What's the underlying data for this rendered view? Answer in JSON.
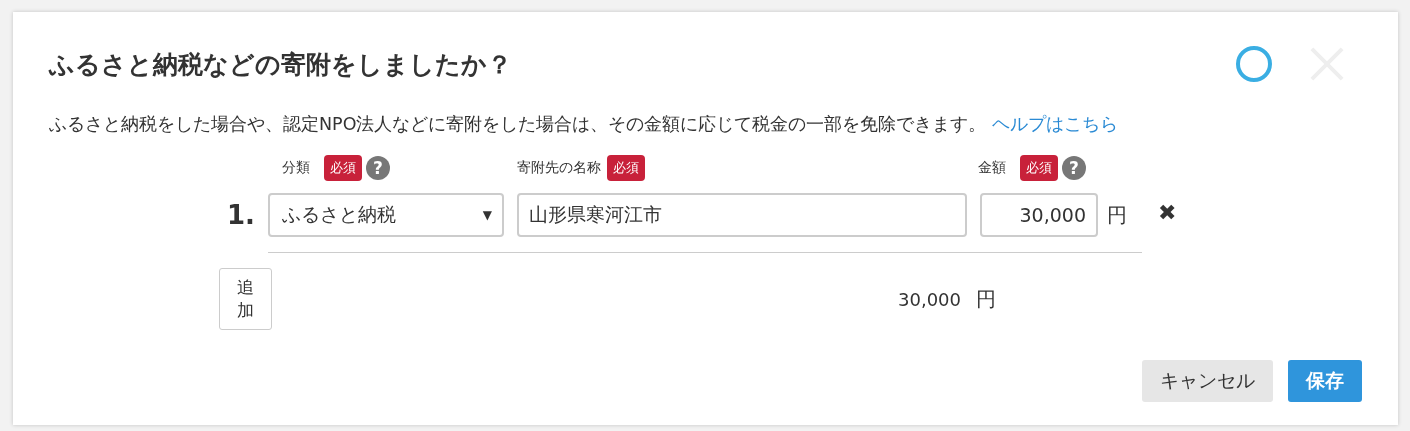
{
  "dialog": {
    "title": "ふるさと納税などの寄附をしましたか？",
    "description": "ふるさと納税をした場合や、認定NPO法人などに寄附をした場合は、その金額に応じて税金の一部を免除できます。",
    "help_link": "ヘルプはこちら"
  },
  "columns": [
    {
      "label": "分類",
      "required": "必須",
      "help": "?"
    },
    {
      "label": "寄附先の名称",
      "required": "必須"
    },
    {
      "label": "金額",
      "required": "必須",
      "help": "?"
    }
  ],
  "rows": [
    {
      "number": "1.",
      "category": "ふるさと納税",
      "category_caret": "▼",
      "name": "山形県寒河江市",
      "amount": "30,000",
      "unit": "円",
      "remove": "✖"
    }
  ],
  "add_button": "追加",
  "total": {
    "amount": "30,000",
    "unit": "円"
  },
  "buttons": [
    {
      "label": "キャンセル",
      "kind": "secondary"
    },
    {
      "label": "保存",
      "kind": "primary"
    }
  ]
}
